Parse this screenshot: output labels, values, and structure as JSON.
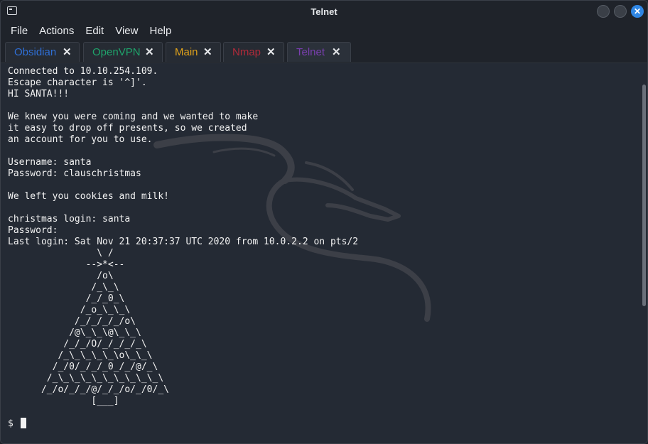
{
  "window": {
    "title": "Telnet",
    "close_glyph": "✕"
  },
  "menu": [
    "File",
    "Actions",
    "Edit",
    "View",
    "Help"
  ],
  "tabs": [
    {
      "label": "Obsidian",
      "color": "#2f6fd6"
    },
    {
      "label": "OpenVPN",
      "color": "#1fa36b"
    },
    {
      "label": "Main",
      "color": "#e0a21b"
    },
    {
      "label": "Nmap",
      "color": "#b02a3a"
    },
    {
      "label": "Telnet",
      "color": "#7a3fb0",
      "active": true
    }
  ],
  "tab_close_glyph": "✕",
  "terminal": {
    "output": "Connected to 10.10.254.109.\nEscape character is '^]'.\nHI SANTA!!!\n\nWe knew you were coming and we wanted to make\nit easy to drop off presents, so we created\nan account for you to use.\n\nUsername: santa\nPassword: clauschristmas\n\nWe left you cookies and milk!\n\nchristmas login: santa\nPassword:\nLast login: Sat Nov 21 20:37:37 UTC 2020 from 10.0.2.2 on pts/2\n                \\ /\n              -->*<--\n                /o\\\n               /_\\_\\\n              /_/_0_\\\n             /_o_\\_\\_\\\n            /_/_/_/_/o\\\n           /@\\_\\_\\@\\_\\_\\\n          /_/_/O/_/_/_/_\\\n         /_\\_\\_\\_\\_\\o\\_\\_\\\n        /_/0/_/_/_0_/_/@/_\\\n       /_\\_\\_\\_\\_\\_\\_\\_\\_\\_\\\n      /_/o/_/_/@/_/_/o/_/0/_\\\n               [___]",
    "prompt": "$"
  }
}
